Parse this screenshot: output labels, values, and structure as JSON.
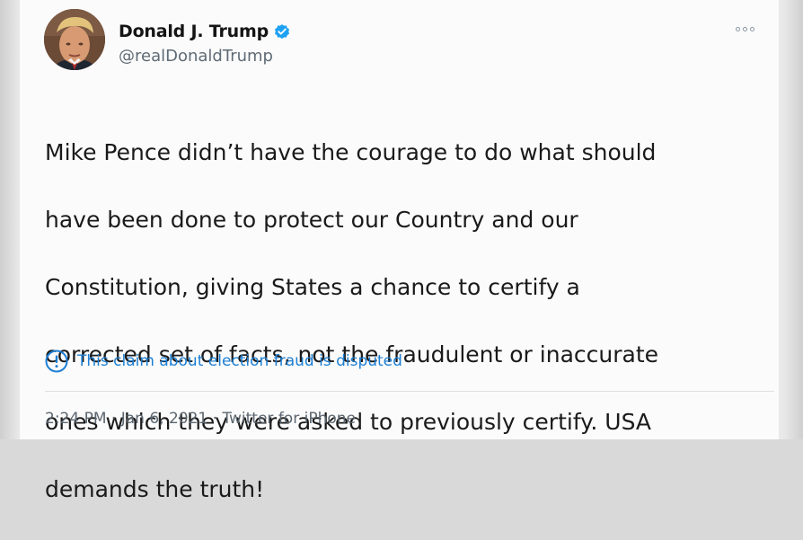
{
  "author": {
    "display_name": "Donald J. Trump",
    "handle": "@realDonaldTrump"
  },
  "tweet": {
    "lines": [
      "Mike Pence didn’t have the courage to do what should",
      "have been done to protect our Country and our",
      "Constitution, giving States a chance to certify a",
      "corrected set of facts, not the fraudulent or inaccurate",
      "ones which they were asked to previously certify. USA",
      "demands the truth!"
    ]
  },
  "notice": {
    "icon": "info-circle-icon",
    "text": "This claim about election fraud is disputed"
  },
  "meta": {
    "time": "2:24 PM",
    "separator": " · ",
    "date": "Jan 6, 2021",
    "source": "Twitter for iPhone"
  },
  "colors": {
    "link_blue": "#1d7fd4",
    "verified_blue": "#1da1f2",
    "secondary_text": "#5c6670"
  },
  "icons": {
    "verified": "verified-badge-icon",
    "more": "more-options-icon"
  }
}
